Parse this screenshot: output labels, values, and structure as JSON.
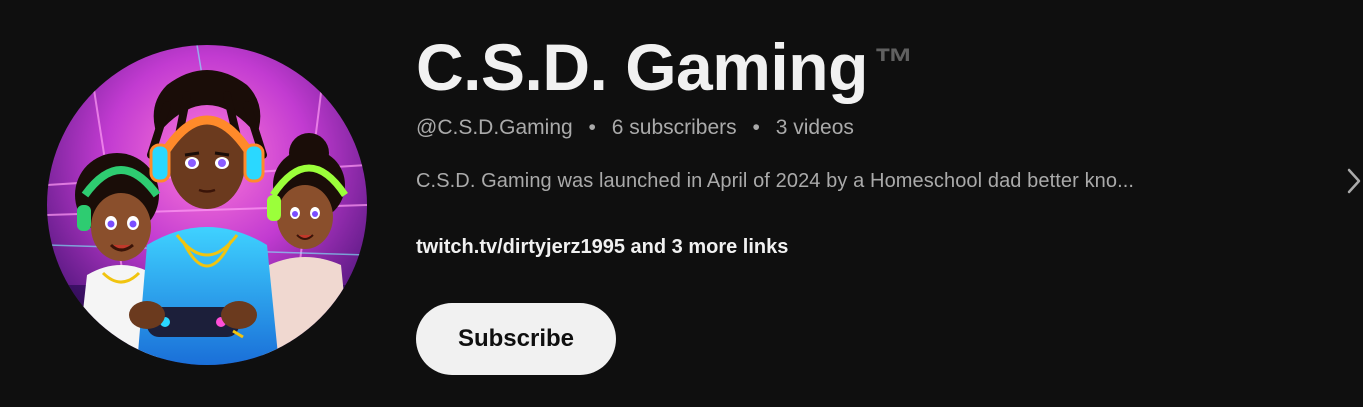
{
  "channel": {
    "name": "C.S.D. Gaming",
    "trademark": "™",
    "handle": "@C.S.D.Gaming",
    "subscribers": "6 subscribers",
    "videos": "3 videos",
    "separator": "•",
    "description": "C.S.D. Gaming was launched in April of 2024 by a Homeschool dad better kno...",
    "links_text": "twitch.tv/dirtyjerz1995 and 3 more links"
  },
  "actions": {
    "subscribe_label": "Subscribe"
  },
  "colors": {
    "background": "#0f0f0f",
    "primary_text": "#f1f1f1",
    "secondary_text": "#aaaaaa",
    "trademark": "#606060",
    "button_bg": "#f1f1f1"
  },
  "icons": {
    "more": "chevron-right-icon",
    "avatar": "channel-avatar-illustration"
  }
}
